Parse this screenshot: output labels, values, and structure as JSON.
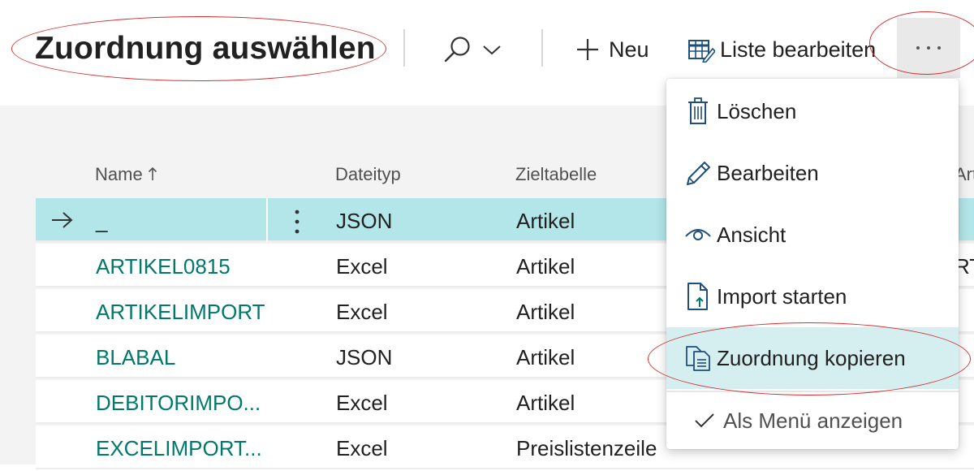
{
  "header": {
    "title": "Zuordnung auswählen",
    "new_label": "Neu",
    "edit_list_label": "Liste bearbeiten",
    "more_label": "..."
  },
  "table": {
    "columns": [
      {
        "label": "Name",
        "sort": "ascending"
      },
      {
        "label": "Dateityp"
      },
      {
        "label": "Zieltabelle"
      },
      {
        "label": "Artik"
      }
    ],
    "rows": [
      {
        "name": "_",
        "file_type": "JSON",
        "target": "Artikel",
        "extra": "",
        "selected": true
      },
      {
        "name": "ARTIKEL0815",
        "file_type": "Excel",
        "target": "Artikel",
        "extra": "RT"
      },
      {
        "name": "ARTIKELIMPORT",
        "file_type": "Excel",
        "target": "Artikel",
        "extra": ""
      },
      {
        "name": "BLABAL",
        "file_type": "JSON",
        "target": "Artikel",
        "extra": ""
      },
      {
        "name": "DEBITORIMPO...",
        "file_type": "Excel",
        "target": "Artikel",
        "extra": ""
      },
      {
        "name": "EXCELIMPORT...",
        "file_type": "Excel",
        "target": "Preislistenzeile",
        "extra": ""
      }
    ]
  },
  "menu": {
    "items": [
      {
        "label": "Löschen",
        "icon": "trash-icon"
      },
      {
        "label": "Bearbeiten",
        "icon": "pencil-icon"
      },
      {
        "label": "Ansicht",
        "icon": "eye-icon"
      },
      {
        "label": "Import starten",
        "icon": "document-import-icon"
      },
      {
        "label": "Zuordnung kopieren",
        "icon": "copy-icon",
        "highlighted": true
      }
    ],
    "toggle": {
      "label": "Als Menü anzeigen",
      "checked": true
    }
  },
  "colors": {
    "accent": "#00796b",
    "selected_row": "#b3e6e8",
    "menu_highlight": "#d5eef0",
    "annotation": "#d32f2f"
  }
}
